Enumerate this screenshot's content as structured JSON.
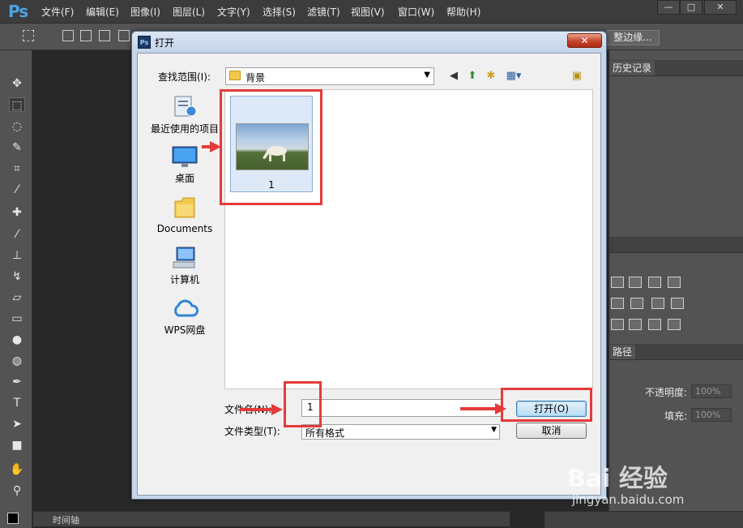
{
  "app": {
    "logo": "Ps",
    "menu": [
      "文件(F)",
      "编辑(E)",
      "图像(I)",
      "图层(L)",
      "文字(Y)",
      "选择(S)",
      "滤镜(T)",
      "视图(V)",
      "窗口(W)",
      "帮助(H)"
    ],
    "window_buttons": [
      "—",
      "□",
      "✕"
    ],
    "options_bar": {
      "refine_edge_label": "整边缘..."
    }
  },
  "right_panel": {
    "history_tab": "历史记录",
    "paths_tab": "路径",
    "opacity_label": "不透明度:",
    "opacity_value": "100%",
    "fill_label": "填充:",
    "fill_value": "100%"
  },
  "timeline": {
    "label": "时间轴"
  },
  "dialog": {
    "title": "打开",
    "close_glyph": "✕",
    "look_in_label": "查找范围(I):",
    "look_in_value": "背景",
    "places": [
      {
        "label": "最近使用的项目",
        "icon": "recent-items-icon"
      },
      {
        "label": "桌面",
        "icon": "desktop-icon"
      },
      {
        "label": "Documents",
        "icon": "documents-folder-icon"
      },
      {
        "label": "计算机",
        "icon": "computer-icon"
      },
      {
        "label": "WPS网盘",
        "icon": "wps-cloud-icon"
      }
    ],
    "files": [
      {
        "name": "1",
        "thumbnail": "horse-grazing-thumbnail"
      }
    ],
    "filename_label": "文件名(N):",
    "filename_value": "1",
    "filetype_label": "文件类型(T):",
    "filetype_value": "所有格式",
    "open_button": "打开(O)",
    "cancel_button": "取消"
  },
  "annotations_color": "#e53a3a",
  "watermark": {
    "logo": "Bai 经验",
    "url": "jingyan.baidu.com"
  }
}
